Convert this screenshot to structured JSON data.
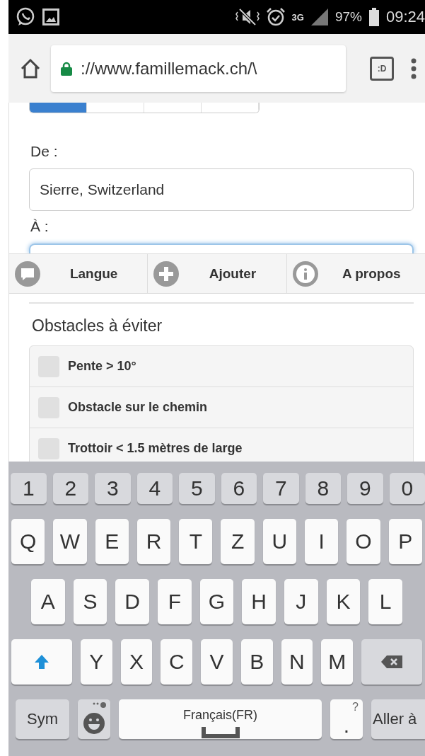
{
  "status_bar": {
    "network": "3G",
    "battery": "97%",
    "time": "09:24"
  },
  "browser": {
    "url": "://www.famillemack.ch/\\",
    "tab_count": ":D"
  },
  "segments": [
    {
      "selected": true
    },
    {
      "selected": false
    },
    {
      "selected": false
    },
    {
      "selected": false
    }
  ],
  "form": {
    "from_label": "De :",
    "from_value": "Sierre, Switzerland",
    "to_label": "À :"
  },
  "nav_items": [
    {
      "kind": "chat",
      "label": "Langue"
    },
    {
      "kind": "plus",
      "label": "Ajouter"
    },
    {
      "kind": "info",
      "label": "A propos"
    }
  ],
  "obstacles": {
    "title": "Obstacles à éviter",
    "items": [
      {
        "label": "Pente > 10°",
        "checked": false
      },
      {
        "label": "Obstacle sur le chemin",
        "checked": false
      },
      {
        "label": "Trottoir < 1.5 mètres de large",
        "checked": false
      }
    ]
  },
  "keyboard": {
    "rows": [
      {
        "keys": [
          {
            "kind": "digit",
            "label": "1"
          },
          {
            "kind": "digit",
            "label": "2"
          },
          {
            "kind": "digit",
            "label": "3"
          },
          {
            "kind": "digit",
            "label": "4"
          },
          {
            "kind": "digit",
            "label": "5"
          },
          {
            "kind": "digit",
            "label": "6"
          },
          {
            "kind": "digit",
            "label": "7"
          },
          {
            "kind": "digit",
            "label": "8"
          },
          {
            "kind": "digit",
            "label": "9"
          },
          {
            "kind": "digit",
            "label": "0"
          }
        ]
      },
      {
        "keys": [
          {
            "kind": "char",
            "label": "Q"
          },
          {
            "kind": "char",
            "label": "W"
          },
          {
            "kind": "char",
            "label": "E"
          },
          {
            "kind": "char",
            "label": "R"
          },
          {
            "kind": "char",
            "label": "T"
          },
          {
            "kind": "char",
            "label": "Z"
          },
          {
            "kind": "char",
            "label": "U"
          },
          {
            "kind": "char",
            "label": "I"
          },
          {
            "kind": "char",
            "label": "O"
          },
          {
            "kind": "char",
            "label": "P"
          }
        ]
      },
      {
        "keys": [
          {
            "kind": "char",
            "label": "A"
          },
          {
            "kind": "char",
            "label": "S"
          },
          {
            "kind": "char",
            "label": "D"
          },
          {
            "kind": "char",
            "label": "F"
          },
          {
            "kind": "char",
            "label": "G"
          },
          {
            "kind": "char",
            "label": "H"
          },
          {
            "kind": "char",
            "label": "J"
          },
          {
            "kind": "char",
            "label": "K"
          },
          {
            "kind": "char",
            "label": "L"
          }
        ]
      },
      {
        "keys": [
          {
            "kind": "shift"
          },
          {
            "kind": "char",
            "label": "Y"
          },
          {
            "kind": "char",
            "label": "X"
          },
          {
            "kind": "char",
            "label": "C"
          },
          {
            "kind": "char",
            "label": "V"
          },
          {
            "kind": "char",
            "label": "B"
          },
          {
            "kind": "char",
            "label": "N"
          },
          {
            "kind": "char",
            "label": "M"
          },
          {
            "kind": "backspace"
          }
        ]
      }
    ],
    "bottom_row": [
      {
        "kind": "sym",
        "label": "Sym"
      },
      {
        "kind": "emoji"
      },
      {
        "kind": "space",
        "label": "Français(FR)"
      },
      {
        "kind": "period",
        "label": ".",
        "hint": "?"
      },
      {
        "kind": "action",
        "label": "Aller à"
      }
    ]
  }
}
